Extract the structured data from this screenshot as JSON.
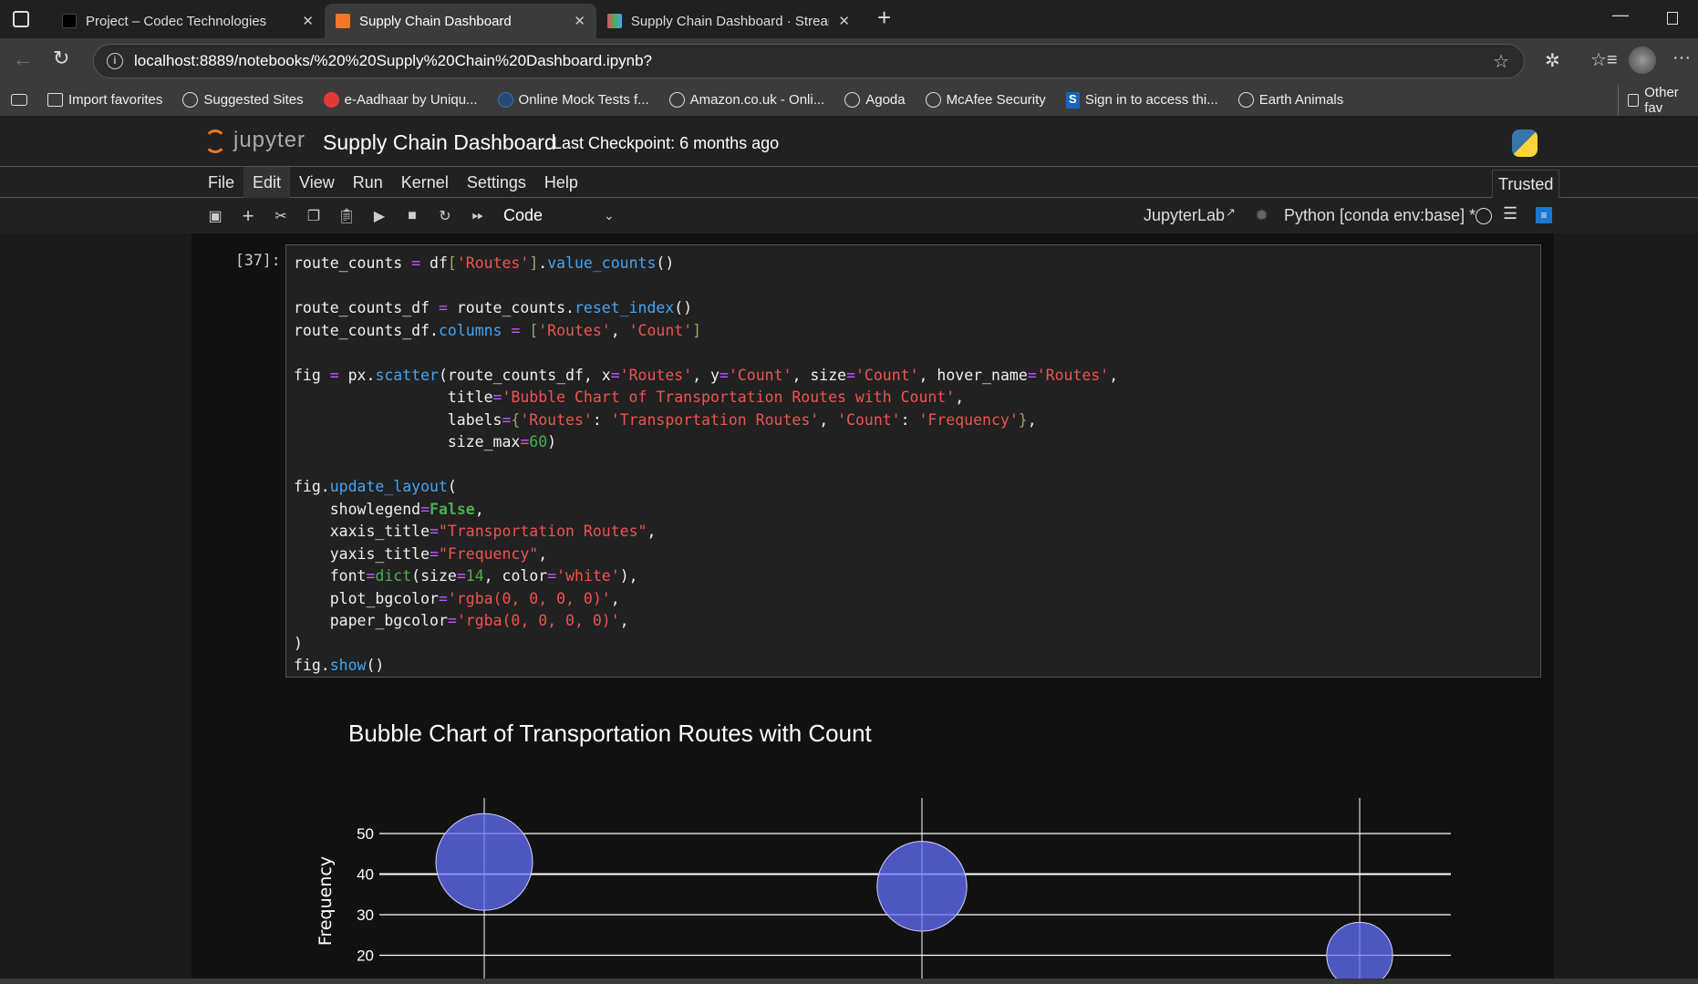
{
  "browser": {
    "tabs": [
      {
        "title": "Project – Codec Technologies"
      },
      {
        "title": "Supply Chain Dashboard"
      },
      {
        "title": "Supply Chain Dashboard · Streaml"
      }
    ],
    "url": "localhost:8889/notebooks/%20%20Supply%20Chain%20Dashboard.ipynb?",
    "bookmarks": [
      "Import favorites",
      "Suggested Sites",
      "e-Aadhaar by Uniqu...",
      "Online Mock Tests f...",
      "Amazon.co.uk - Onli...",
      "Agoda",
      "McAfee Security",
      "Sign in to access thi...",
      "Earth Animals"
    ],
    "other_favorites": "Other fav"
  },
  "jupyter": {
    "logo": "jupyter",
    "notebook_title": "Supply Chain Dashboard",
    "checkpoint": "Last Checkpoint: 6 months ago",
    "menu": [
      "File",
      "Edit",
      "View",
      "Run",
      "Kernel",
      "Settings",
      "Help"
    ],
    "trusted": "Trusted",
    "cell_type": "Code",
    "jupyterlab": "JupyterLab",
    "kernel": "Python [conda env:base] *"
  },
  "cell": {
    "prompt": "[37]:"
  },
  "chart_data": {
    "type": "scatter",
    "title": "Bubble Chart of Transportation Routes with Count",
    "xlabel": "Transportation Routes",
    "ylabel": "Frequency",
    "x": [
      0,
      1,
      2
    ],
    "values": [
      43,
      37,
      20
    ],
    "yticks": [
      "20",
      "30",
      "40",
      "50"
    ],
    "ylim": [
      15,
      58
    ],
    "marker_color": "#636efa",
    "grid": true
  }
}
